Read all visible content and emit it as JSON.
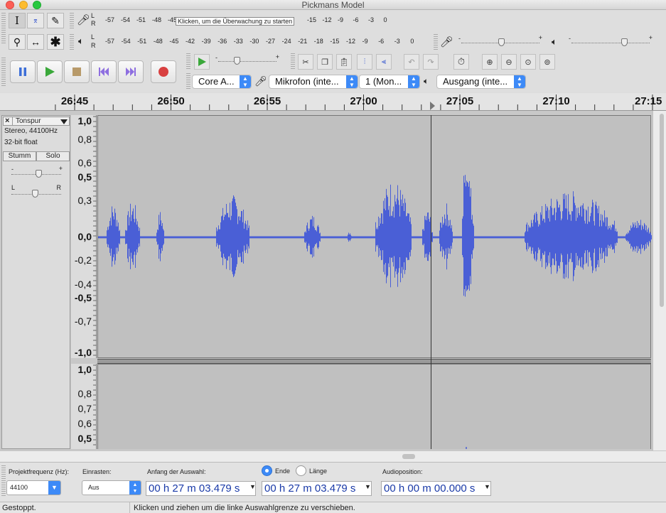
{
  "window": {
    "title": "Pickmans Model"
  },
  "colors": {
    "waveform": "#4a5fd6",
    "waveform_bg": "#c0c0c0",
    "accent": "#3d8af7"
  },
  "meters": {
    "record_ticks": [
      "-57",
      "-54",
      "-51",
      "-48",
      "-45",
      "-15",
      "-12",
      "-9",
      "-6",
      "-3",
      "0"
    ],
    "record_hint": "Klicken, um die Überwachung zu starten",
    "play_ticks": [
      "-57",
      "-54",
      "-51",
      "-48",
      "-45",
      "-42",
      "-39",
      "-36",
      "-33",
      "-30",
      "-27",
      "-24",
      "-21",
      "-18",
      "-15",
      "-12",
      "-9",
      "-6",
      "-3",
      "0"
    ],
    "l": "L",
    "r": "R"
  },
  "devices": {
    "host": "Core A...",
    "input": "Mikrofon (inte...",
    "channels": "1 (Mon...",
    "output": "Ausgang (inte..."
  },
  "timeline": {
    "labels": [
      "26:45",
      "26:50",
      "26:55",
      "27:00",
      "27:05",
      "27:10",
      "27:15"
    ]
  },
  "track": {
    "name": "Tonspur",
    "info1": "Stereo, 44100Hz",
    "info2": "32-bit float",
    "mute": "Stumm",
    "solo": "Solo",
    "gain_minus": "-",
    "gain_plus": "+",
    "pan_l": "L",
    "pan_r": "R"
  },
  "vruler_top": [
    "1,0",
    "0,8",
    "0,6",
    "0,5",
    "0,3",
    "0,0",
    "-0,2",
    "-0,4",
    "-0,5",
    "-0,7",
    "-1,0"
  ],
  "vruler_bottom": [
    "1,0",
    "0,8",
    "0,7",
    "0,6",
    "0,5"
  ],
  "selection_bar": {
    "rate_label": "Projektfrequenz (Hz):",
    "rate_value": "44100",
    "snap_label": "Einrasten:",
    "snap_value": "Aus",
    "start_label": "Anfang der Auswahl:",
    "end_label": "Ende",
    "length_label": "Länge",
    "position_label": "Audioposition:",
    "start_time": "00 h 27 m 03.479 s",
    "end_time": "00 h 27 m 03.479 s",
    "position_time": "00 h 00 m 00.000 s"
  },
  "status": {
    "state": "Gestoppt.",
    "hint": "Klicken und ziehen um die linke Auswahlgrenze zu verschieben."
  }
}
